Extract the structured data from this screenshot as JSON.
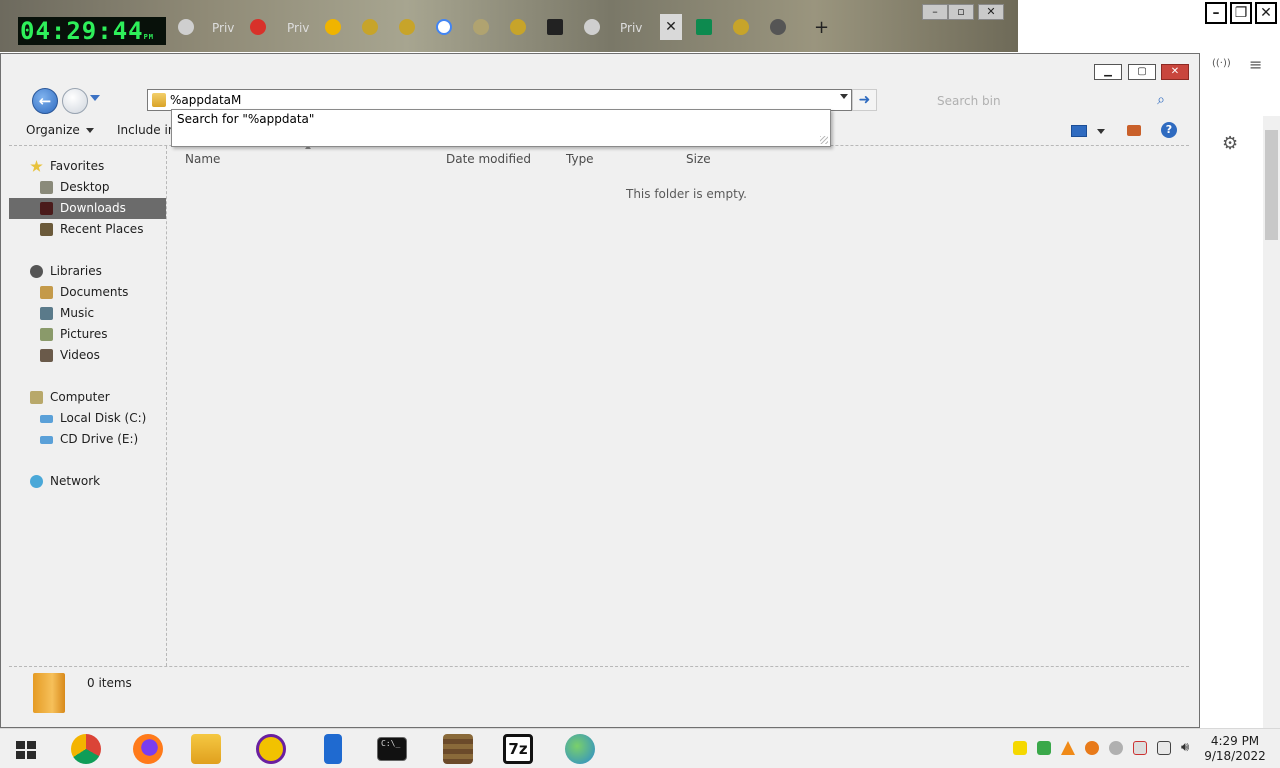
{
  "browser": {
    "clock": "04:29:44",
    "clock_suffix": "PM",
    "tabs": [
      {
        "label": "Priv"
      },
      {
        "label": "Priv"
      },
      {
        "label": "Priv"
      }
    ],
    "new_tab_label": "+",
    "close_tab_label": "✕"
  },
  "explorer": {
    "address_value": "%appdataM",
    "suggestion": "Search for \"%appdata\"",
    "search_placeholder": "Search bin",
    "toolbar": {
      "organize": "Organize",
      "include": "Include in"
    },
    "nav": {
      "favorites": "Favorites",
      "desktop": "Desktop",
      "downloads": "Downloads",
      "recent": "Recent Places",
      "libraries": "Libraries",
      "documents": "Documents",
      "music": "Music",
      "pictures": "Pictures",
      "videos": "Videos",
      "computer": "Computer",
      "local_disk": "Local Disk (C:)",
      "cd_drive": "CD Drive (E:)",
      "network": "Network"
    },
    "columns": {
      "name": "Name",
      "date": "Date modified",
      "type": "Type",
      "size": "Size"
    },
    "empty_message": "This folder is empty.",
    "status": "0 items"
  },
  "taskbar": {
    "time": "4:29 PM",
    "date": "9/18/2022",
    "app_7z_label": "7z"
  },
  "colors": {
    "selection": "#6b6b6b",
    "accent": "#2f6bc0",
    "clock_fg": "#2ef05a"
  }
}
